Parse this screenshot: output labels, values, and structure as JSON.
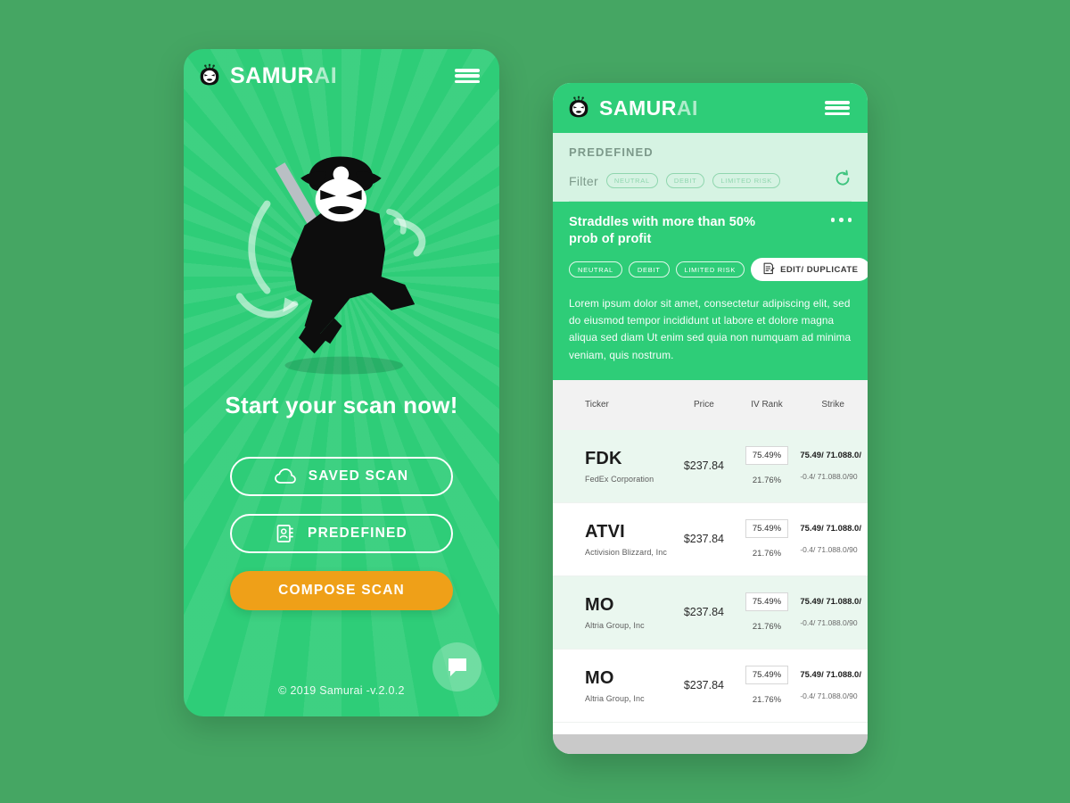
{
  "colors": {
    "page_background": "#45a663",
    "brand_green": "#2ecd78",
    "mint_band": "#d6f3e3",
    "accent_orange": "#efa018",
    "white": "#ffffff",
    "row_alt": "#eaf7ef",
    "table_header_bg": "#f2f2f2"
  },
  "phone_one": {
    "header": {
      "logo_main": "SAMUR",
      "logo_accent": "AI",
      "logo_icon": "samurai-mask-icon",
      "menu_icon": "hamburger-menu-icon"
    },
    "hero": {
      "illustration": "samurai-warrior-illustration",
      "headline": "Start your scan now!"
    },
    "buttons": [
      {
        "label": "SAVED SCAN",
        "icon": "cloud-icon",
        "style": "outline"
      },
      {
        "label": "PREDEFINED",
        "icon": "contact-book-icon",
        "style": "outline"
      },
      {
        "label": "COMPOSE SCAN",
        "icon": "none",
        "style": "solid"
      }
    ],
    "footer": {
      "copyright": "© 2019 Samurai -v.2.0.2",
      "fab_icon": "chat-bubble-icon"
    }
  },
  "phone_two": {
    "header": {
      "logo_main": "SAMUR",
      "logo_accent": "AI",
      "logo_icon": "samurai-mask-icon",
      "menu_icon": "hamburger-menu-icon"
    },
    "predefined": {
      "section_title": "PREDEFINED",
      "filter_label": "Filter",
      "filter_chips": [
        "NEUTRAL",
        "DEBIT",
        "LIMITED RISK"
      ],
      "refresh_icon": "refresh-icon"
    },
    "scan_card": {
      "title": "Straddles with more than 50% prob of profit",
      "menu_icon": "more-options-icon",
      "tags": [
        "NEUTRAL",
        "DEBIT",
        "LIMITED RISK"
      ],
      "edit_button_label": "EDIT/ DUPLICATE",
      "edit_button_icon": "edit-document-icon",
      "description": "Lorem ipsum dolor sit amet, consectetur adipiscing elit, sed do eiusmod tempor incididunt ut labore et dolore magna aliqua sed diam Ut enim sed quia non numquam ad minima veniam, quis nostrum."
    },
    "table": {
      "columns": [
        "Ticker",
        "Price",
        "IV Rank",
        "Strike"
      ],
      "rows": [
        {
          "ticker": "FDK",
          "company": "FedEx Corporation",
          "price": "$237.84",
          "iv_rank": "75.49%",
          "iv_sub": "21.76%",
          "strike_main": "75.49/ 71.088.0/",
          "strike_sub": "-0.4/ 71.088.0/90"
        },
        {
          "ticker": "ATVI",
          "company": "Activision Blizzard, Inc",
          "price": "$237.84",
          "iv_rank": "75.49%",
          "iv_sub": "21.76%",
          "strike_main": "75.49/ 71.088.0/",
          "strike_sub": "-0.4/ 71.088.0/90"
        },
        {
          "ticker": "MO",
          "company": "Altria Group, Inc",
          "price": "$237.84",
          "iv_rank": "75.49%",
          "iv_sub": "21.76%",
          "strike_main": "75.49/ 71.088.0/",
          "strike_sub": "-0.4/ 71.088.0/90"
        },
        {
          "ticker": "MO",
          "company": "Altria Group, Inc",
          "price": "$237.84",
          "iv_rank": "75.49%",
          "iv_sub": "21.76%",
          "strike_main": "75.49/ 71.088.0/",
          "strike_sub": "-0.4/ 71.088.0/90"
        }
      ]
    }
  }
}
